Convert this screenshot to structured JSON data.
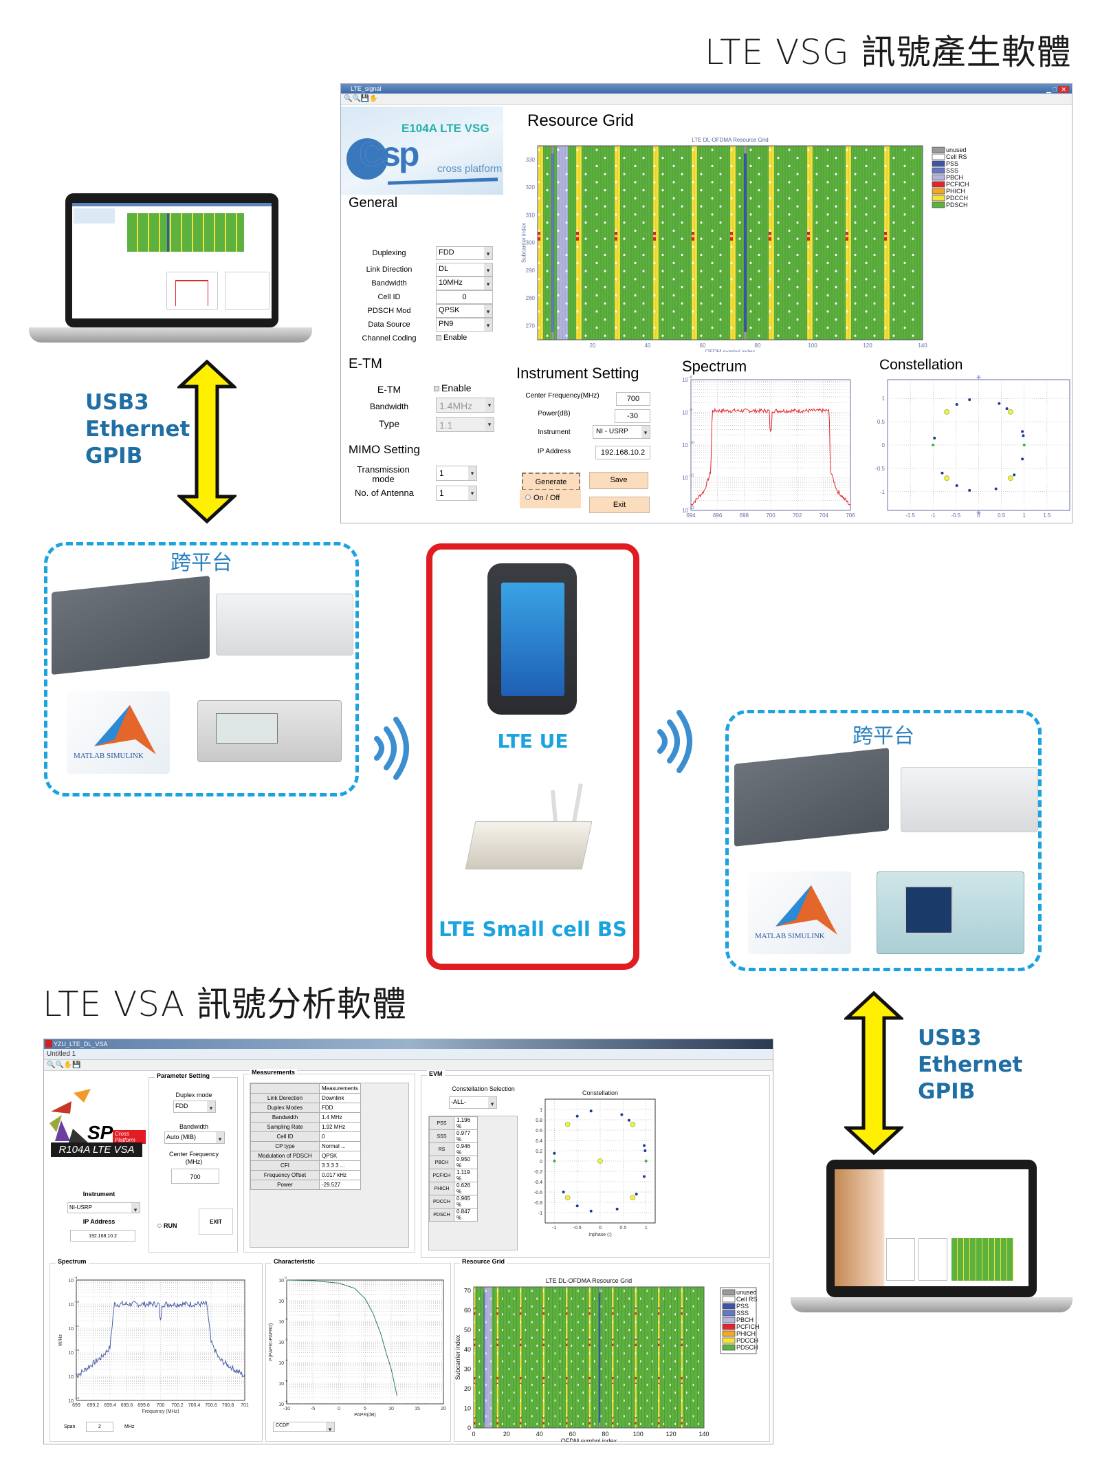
{
  "headings": {
    "vsg_title": "LTE VSG 訊號產生軟體",
    "vsa_title": "LTE VSA 訊號分析軟體"
  },
  "connection_labels": {
    "left": [
      "USB3",
      "Ethernet",
      "GPIB"
    ],
    "right": [
      "USB3",
      "Ethernet",
      "GPIB"
    ]
  },
  "platforms": {
    "left_title": "跨平台",
    "right_title": "跨平台",
    "items": [
      "SDR board",
      "USRP N210",
      "MATLAB SIMULINK",
      "Signal generator",
      "Signal analyzer"
    ],
    "matlab_label": "MATLAB SIMULINK"
  },
  "devices": {
    "ue_label": "LTE UE",
    "bs_label": "LTE Small cell BS"
  },
  "colors": {
    "accent_blue": "#1aa3e0",
    "link_text": "#1f6ea4",
    "arrow_yellow": "#ffef00",
    "frame_red": "#e11b22",
    "pdsch": "#5db13e",
    "pdcch": "#f5e23a",
    "pss": "#3c55a8",
    "sss": "#6677c4",
    "pbch": "#b3b6e0",
    "pcfich": "#e3242b",
    "phich": "#f5a623",
    "unused": "#999999"
  },
  "vsg": {
    "window_title": "LTE_signal",
    "logo_product": "E104A LTE VSG",
    "logo_brand": "Csp",
    "logo_sub": "cross platform",
    "general": {
      "title": "General",
      "fields": [
        {
          "label": "Duplexing",
          "value": "FDD",
          "type": "dropdown"
        },
        {
          "label": "Link Direction",
          "value": "DL",
          "type": "dropdown"
        },
        {
          "label": "Bandwidth",
          "value": "10MHz",
          "type": "dropdown"
        },
        {
          "label": "Cell ID",
          "value": "0",
          "type": "input"
        },
        {
          "label": "PDSCH Mod",
          "value": "QPSK",
          "type": "dropdown"
        },
        {
          "label": "Data Source",
          "value": "PN9",
          "type": "dropdown"
        },
        {
          "label": "Channel Coding",
          "value": "Enable",
          "type": "checkbox"
        }
      ]
    },
    "etm": {
      "title": "E-TM",
      "etm_label": "E-TM",
      "etm_value": "Enable",
      "bandwidth_label": "Bandwidth",
      "bandwidth_value": "1.4MHz",
      "type_label": "Type",
      "type_value": "1.1"
    },
    "mimo": {
      "title": "MIMO Setting",
      "tm_label": "Transmission mode",
      "tm_value": "1",
      "ant_label": "No. of Antenna",
      "ant_value": "1"
    },
    "instrument": {
      "title": "Instrument Setting",
      "center_freq_label": "Center Frequency(MHz)",
      "center_freq": "700",
      "power_label": "Power(dB)",
      "power": "-30",
      "instrument_label": "Instrument",
      "instrument": "NI - USRP",
      "ip_label": "IP Address",
      "ip": "192.168.10.2",
      "generate": "Generate",
      "save": "Save",
      "onoff": "On / Off",
      "exit": "Exit"
    },
    "resource_grid_title": "Resource Grid",
    "spectrum_title": "Spectrum",
    "constellation_title": "Constellation"
  },
  "vsa": {
    "window_title": "YZU_LTE_DL_VSA",
    "doc_title": "Untitled 1",
    "logo_brand": "SP",
    "logo_tag": "Cross Platform",
    "logo_product": "R104A LTE VSA",
    "instrument_label": "Instrument",
    "instrument": "NI-USRP",
    "ip_label": "IP Address",
    "ip": "192.168.10.2",
    "param": {
      "title": "Parameter Setting",
      "duplex_label": "Duplex mode",
      "duplex": "FDD",
      "bw_label": "Bandwidth",
      "bw": "Auto (MIB)",
      "cf_label": "Center Frequency (MHz)",
      "cf": "700",
      "run": "RUN",
      "exit": "EXIT"
    },
    "measurements": {
      "title": "Measurements",
      "col_header": "Measurements",
      "rows": [
        {
          "k": "Link Derection",
          "v": "Downlink"
        },
        {
          "k": "Duplex Modes",
          "v": "FDD"
        },
        {
          "k": "Bandwidth",
          "v": "1.4 MHz"
        },
        {
          "k": "Sampling Rate",
          "v": "1.92 MHz"
        },
        {
          "k": "Cell ID",
          "v": "0"
        },
        {
          "k": "CP type",
          "v": "Normal ..."
        },
        {
          "k": "Modulation of PDSCH",
          "v": "QPSK"
        },
        {
          "k": "CFI",
          "v": "3 3 3 3 ..."
        },
        {
          "k": "Frequency Offset",
          "v": "0.017 kHz"
        },
        {
          "k": "Power",
          "v": "-29.527"
        }
      ]
    },
    "evm": {
      "title": "EVM",
      "sel_label": "Constellation Selection",
      "sel_value": "-ALL-",
      "rows": [
        {
          "k": "PSS",
          "v": "1.196 %"
        },
        {
          "k": "SSS",
          "v": "0.977 %"
        },
        {
          "k": "RS",
          "v": "0.946 %"
        },
        {
          "k": "PBCH",
          "v": "0.950 %"
        },
        {
          "k": "PCFICH",
          "v": "1.119 %"
        },
        {
          "k": "PHICH",
          "v": "0.626 %"
        },
        {
          "k": "PDCCH",
          "v": "0.965 %"
        },
        {
          "k": "PDSCH",
          "v": "0.847 %"
        }
      ]
    },
    "spectrum_title": "Spectrum",
    "span_label": "Span",
    "span_value": "2",
    "span_unit": "MHz",
    "characteristic_title": "Characteristic",
    "ccdf_select": "CCDF",
    "resource_grid_title": "Resource Grid"
  },
  "chart_data": [
    {
      "id": "vsg_resource_grid",
      "type": "heatmap",
      "title": "LTE DL-OFDMA Resource Grid",
      "xlabel": "OFDM symbol index",
      "ylabel": "Subcarrier index",
      "xlim": [
        0,
        140
      ],
      "ylim": [
        265,
        335
      ],
      "xticks": [
        20,
        40,
        60,
        80,
        100,
        120,
        140
      ],
      "yticks": [
        270,
        280,
        290,
        300,
        310,
        320,
        330
      ],
      "legend": [
        "unused",
        "Cell RS",
        "PSS",
        "SSS",
        "PBCH",
        "PCFICH",
        "PHICH",
        "PDCCH",
        "PDSCH"
      ],
      "legend_position": "right",
      "pdcch_symbol_starts": [
        0,
        14,
        28,
        42,
        56,
        70,
        84,
        98,
        112,
        126
      ],
      "pss_symbol": 75,
      "sss_symbol": 5,
      "pbch_symbols": [
        7,
        8,
        9,
        10
      ],
      "pcfich_subcarriers": [
        301,
        303
      ]
    },
    {
      "id": "vsg_spectrum",
      "type": "line",
      "title": "Spectrum",
      "xlim": [
        694,
        706
      ],
      "xticks": [
        694,
        696,
        698,
        700,
        702,
        704,
        706
      ],
      "yscale": "log",
      "ylim_exp": [
        -12,
        -8
      ],
      "ytick_labels": [
        "10^-12",
        "10^-11",
        "10^-10",
        "10^-9",
        "10^-8"
      ],
      "x": [
        694,
        695,
        695.5,
        695.6,
        700,
        704.4,
        704.5,
        705,
        706
      ],
      "y_exp": [
        -11.85,
        -11.4,
        -10.8,
        -8.95,
        -8.95,
        -8.95,
        -10.8,
        -11.4,
        -11.85
      ],
      "notch_at": 700,
      "color": "#e3242b"
    },
    {
      "id": "vsg_constellation",
      "type": "scatter",
      "title": "Constellation",
      "xlim": [
        -2,
        2
      ],
      "ylim": [
        -1.4,
        1.4
      ],
      "xticks": [
        -1.5,
        -1,
        -0.5,
        0,
        0.5,
        1,
        1.5
      ],
      "yticks": [
        -1,
        -0.5,
        0,
        0.5,
        1
      ],
      "series": [
        {
          "name": "blue",
          "points": [
            [
              -0.2,
              0.97
            ],
            [
              -0.48,
              0.87
            ],
            [
              0.45,
              0.89
            ],
            [
              0.62,
              0.78
            ],
            [
              -0.97,
              0.15
            ],
            [
              0.96,
              0.29
            ],
            [
              0.98,
              0.2
            ],
            [
              0.96,
              -0.3
            ],
            [
              -0.8,
              -0.6
            ],
            [
              0.78,
              -0.64
            ],
            [
              -0.48,
              -0.87
            ],
            [
              -0.2,
              -0.97
            ],
            [
              0.38,
              -0.94
            ],
            [
              -0.7,
              0.69
            ]
          ]
        },
        {
          "name": "green",
          "points": [
            [
              -1,
              0
            ],
            [
              1,
              0
            ]
          ]
        },
        {
          "name": "yellow",
          "points": [
            [
              -0.7,
              0.71
            ],
            [
              0.7,
              0.71
            ],
            [
              -0.7,
              -0.71
            ],
            [
              0.7,
              -0.71
            ]
          ]
        },
        {
          "name": "star",
          "points": [
            [
              0,
              1.45
            ],
            [
              0,
              -1.45
            ]
          ]
        }
      ]
    },
    {
      "id": "vsa_constellation",
      "type": "scatter",
      "title": "Constellation",
      "xlabel": "Inphase (:)",
      "xlim": [
        -1.2,
        1.2
      ],
      "ylim": [
        -1.2,
        1.2
      ],
      "xticks": [
        -1,
        -0.5,
        0,
        0.5,
        1
      ],
      "yticks": [
        -1,
        -0.8,
        -0.6,
        -0.4,
        -0.2,
        0,
        0.2,
        0.4,
        0.6,
        0.8,
        1
      ],
      "series": [
        {
          "name": "blue",
          "points": [
            [
              -0.2,
              0.97
            ],
            [
              -0.5,
              0.87
            ],
            [
              0.47,
              0.9
            ],
            [
              0.63,
              0.79
            ],
            [
              -1,
              0.15
            ],
            [
              0.96,
              0.3
            ],
            [
              0.98,
              0.2
            ],
            [
              0.96,
              -0.3
            ],
            [
              -0.8,
              -0.6
            ],
            [
              0.79,
              -0.64
            ],
            [
              -0.5,
              -0.87
            ],
            [
              -0.2,
              -0.97
            ],
            [
              0.37,
              -0.93
            ]
          ]
        },
        {
          "name": "green",
          "points": [
            [
              -1,
              0
            ],
            [
              1,
              0
            ]
          ]
        },
        {
          "name": "yellow",
          "points": [
            [
              -0.71,
              0.71
            ],
            [
              0.71,
              0.71
            ],
            [
              -0.71,
              -0.71
            ],
            [
              0.71,
              -0.71
            ],
            [
              0,
              0
            ]
          ]
        }
      ]
    },
    {
      "id": "vsa_spectrum",
      "type": "line",
      "title": "Spectrum",
      "xlabel": "Frequency (MHz)",
      "ylabel": "W/Hz",
      "xlim": [
        699,
        701
      ],
      "xticks": [
        699,
        699.2,
        699.4,
        699.6,
        699.8,
        700,
        700.2,
        700.4,
        700.6,
        700.8,
        701
      ],
      "yscale": "log",
      "ylim_exp": [
        -14,
        -9
      ],
      "x": [
        699,
        699.3,
        699.4,
        699.45,
        700,
        700.55,
        700.6,
        700.7,
        701
      ],
      "y_exp": [
        -13,
        -12.2,
        -11.8,
        -10.0,
        -10.0,
        -10.0,
        -11.6,
        -12.3,
        -13
      ],
      "notch_at": 700,
      "color": "#4a5fa8"
    },
    {
      "id": "vsa_ccdf",
      "type": "line",
      "title": "Characteristic",
      "xlabel": "PAPR(dB)",
      "ylabel": "P(PAPR>PAPR0)",
      "xlim": [
        -10,
        20
      ],
      "xticks": [
        -10,
        -5,
        0,
        5,
        10,
        15,
        20
      ],
      "yscale": "log",
      "ylim_exp": [
        -6,
        0
      ],
      "x": [
        -10,
        -5,
        0,
        3,
        5,
        6.5,
        8,
        9,
        10,
        11.2
      ],
      "y_exp": [
        0,
        -0.03,
        -0.15,
        -0.4,
        -0.9,
        -1.6,
        -2.6,
        -3.5,
        -4.3,
        -5.7
      ],
      "color": "#2e7d4f"
    },
    {
      "id": "vsa_resource_grid",
      "type": "heatmap",
      "title": "LTE DL-OFDMA Resource Grid",
      "xlabel": "OFDM symbol index",
      "ylabel": "Subcarrier index",
      "xlim": [
        0,
        140
      ],
      "ylim": [
        0,
        72
      ],
      "xticks": [
        0,
        20,
        40,
        60,
        80,
        100,
        120,
        140
      ],
      "yticks": [
        0,
        10,
        20,
        30,
        40,
        50,
        60,
        70
      ],
      "legend": [
        "unused",
        "Cell RS",
        "PSS",
        "SSS",
        "PBCH",
        "PCFICH",
        "PHICH",
        "PDCCH",
        "PDSCH"
      ],
      "legend_position": "right",
      "pdcch_symbol_starts": [
        0,
        14,
        28,
        42,
        56,
        70,
        84,
        98,
        112,
        126
      ],
      "pss_symbol": 76,
      "sss_symbol": 6,
      "pbch_symbols": [
        7,
        8,
        9,
        10
      ]
    }
  ]
}
